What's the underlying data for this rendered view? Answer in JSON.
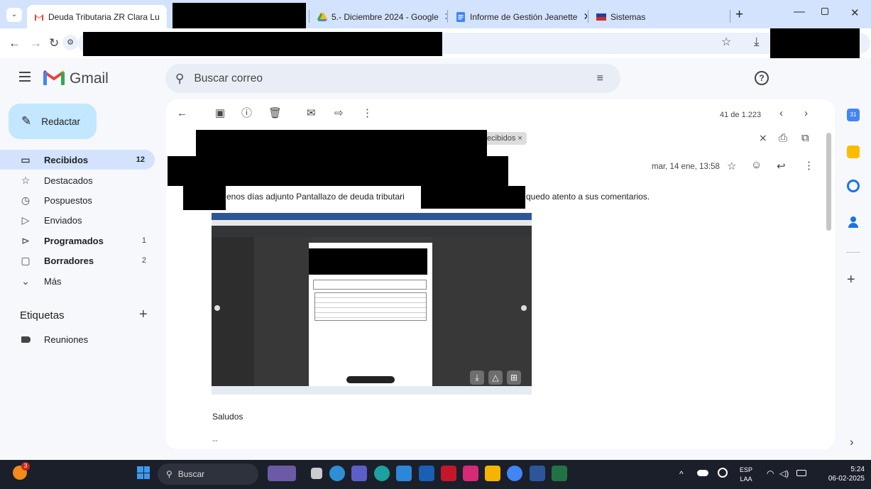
{
  "browser": {
    "tabs": [
      {
        "title": "Deuda Tributaria ZR Clara Lu",
        "active": true,
        "favicon": "gmail-icon"
      },
      {
        "title": "",
        "redacted": true
      },
      {
        "title": "5.- Diciembre 2024 - Google",
        "favicon": "drive-icon"
      },
      {
        "title": "Informe de Gestión Jeanette",
        "favicon": "docs-icon"
      },
      {
        "title": "Sistemas",
        "favicon": "flag-icon"
      }
    ],
    "new_tab": "+"
  },
  "gmail": {
    "brand": "Gmail",
    "search_placeholder": "Buscar correo",
    "compose_label": "Redactar",
    "nav": [
      {
        "label": "Recibidos",
        "count": "12",
        "icon": "inbox-icon"
      },
      {
        "label": "Destacados",
        "count": "",
        "icon": "star-icon"
      },
      {
        "label": "Pospuestos",
        "count": "",
        "icon": "clock-icon"
      },
      {
        "label": "Enviados",
        "count": "",
        "icon": "send-icon"
      },
      {
        "label": "Programados",
        "count": "1",
        "icon": "scheduled-icon"
      },
      {
        "label": "Borradores",
        "count": "2",
        "icon": "draft-icon"
      },
      {
        "label": "Más",
        "count": "",
        "icon": "chevron-down-icon"
      }
    ],
    "labels_header": "Etiquetas",
    "labels": [
      {
        "label": "Reuniones"
      }
    ],
    "toolbar": {
      "pagination": "41 de 1.223"
    },
    "message": {
      "label_chip": "ecibidos ×",
      "date": "mar, 14 ene, 13:58",
      "body_part1": "enos días adjunto Pantallazo de deuda tributari",
      "body_part2": "quedo atento a sus comentarios.",
      "closing": "Saludos",
      "signature_sep": "--"
    }
  },
  "taskbar": {
    "search": "Buscar",
    "lang_top": "ESP",
    "lang_bottom": "LAA",
    "time": "5:24",
    "date": "06-02-2025",
    "badge": "3"
  },
  "colors": {
    "tabstrip": "#d3e3fd",
    "gmail_bg": "#f6f8fc",
    "compose": "#c2e7ff",
    "selected_nav": "#d3e3fd",
    "taskbar": "#1b1f2a"
  }
}
